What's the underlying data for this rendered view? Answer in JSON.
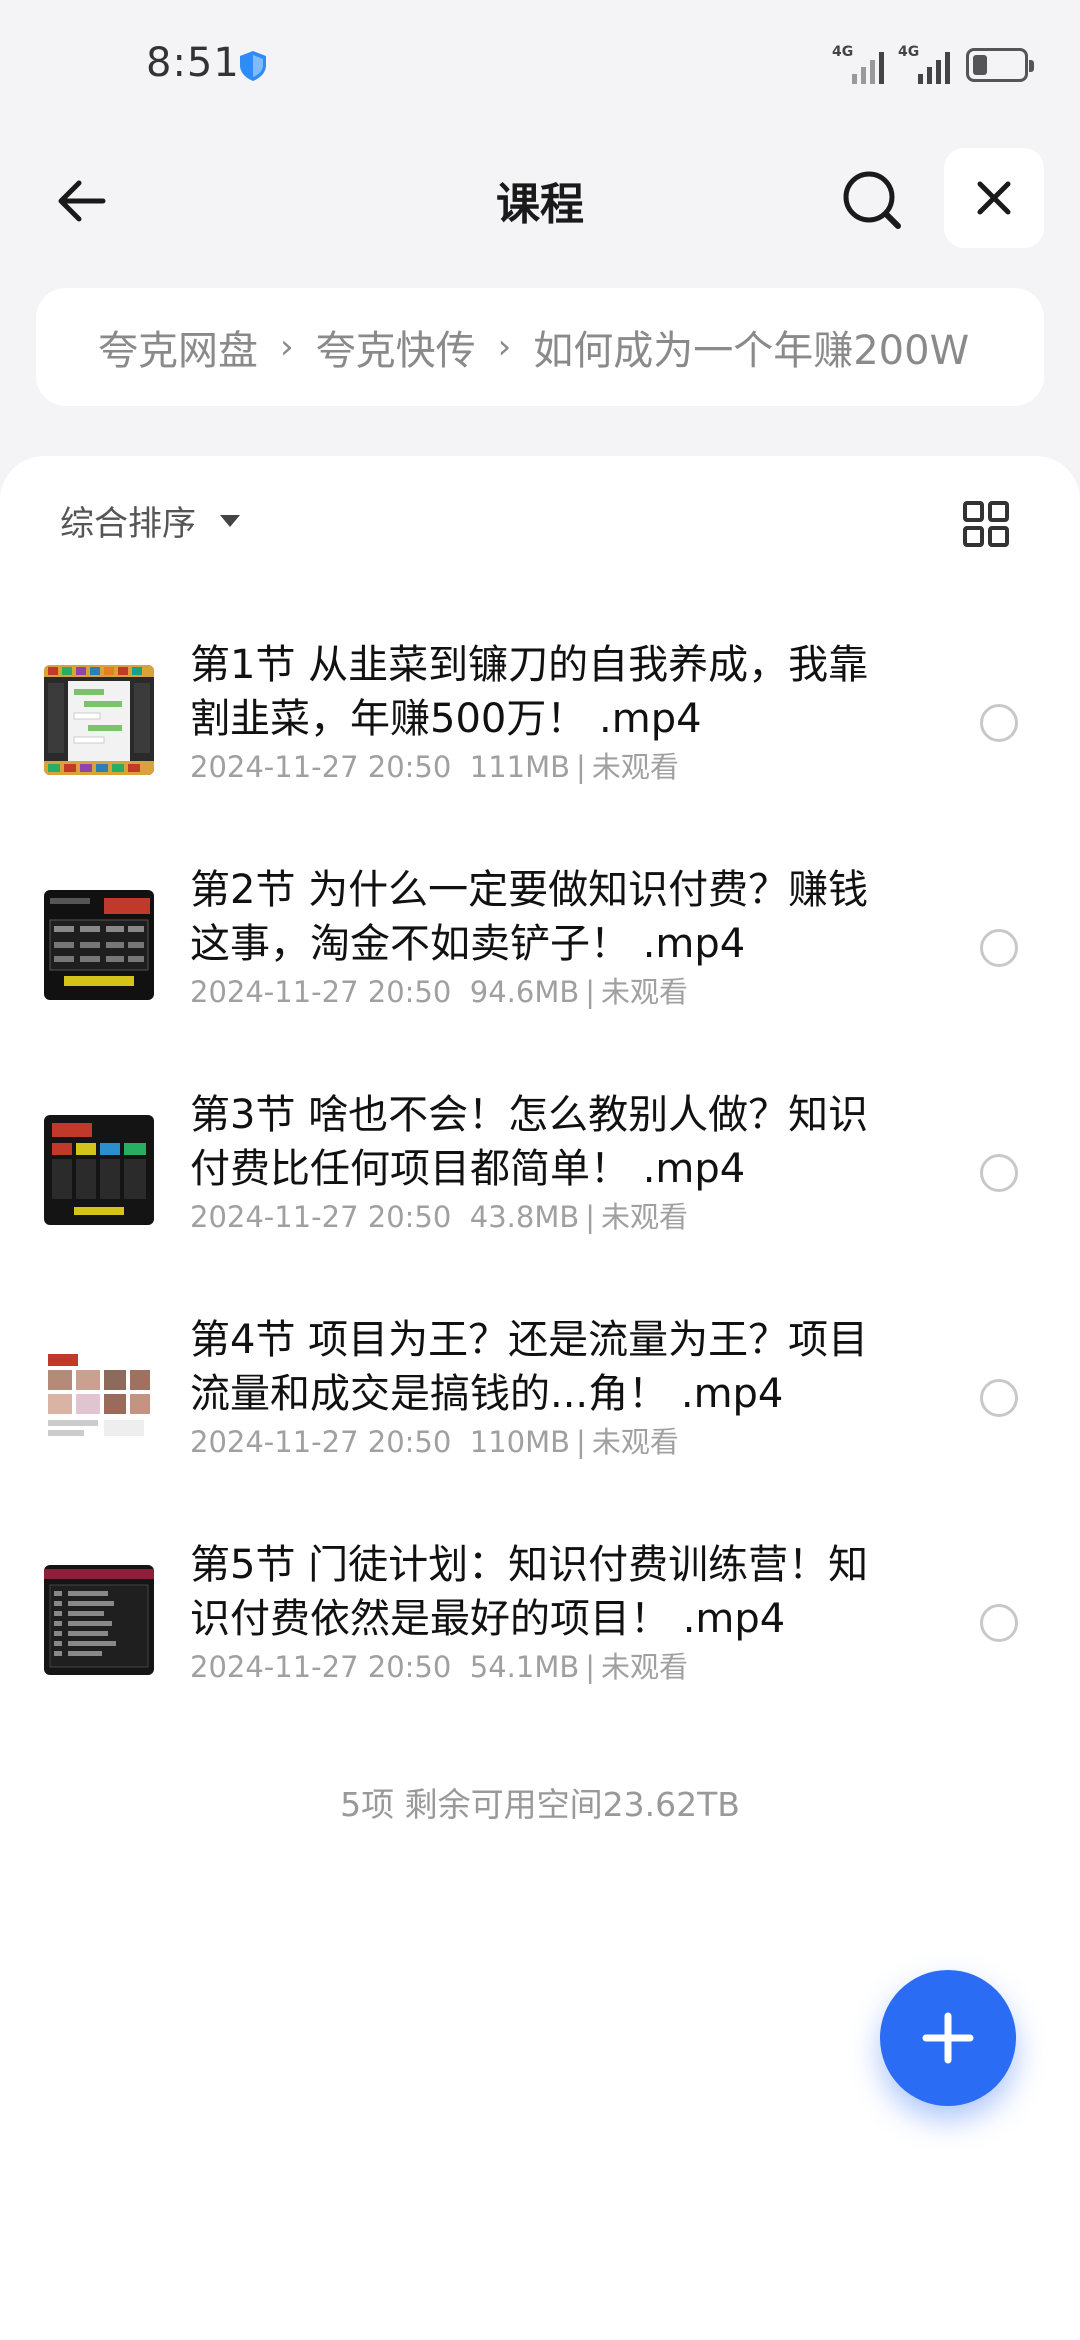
{
  "status_bar": {
    "time": "8:51",
    "network_1": "4G",
    "network_2": "4G",
    "battery_icon": "battery-low-icon"
  },
  "header": {
    "title": "课程",
    "back_icon": "arrow-left-icon",
    "search_icon": "search-icon",
    "close_icon": "close-icon"
  },
  "breadcrumb": {
    "items": [
      "夸克网盘",
      "夸克快传",
      "如何成为一个年赚200W"
    ],
    "separator": "›"
  },
  "toolbar": {
    "sort_label": "综合排序",
    "view_icon": "grid-view-icon"
  },
  "files": [
    {
      "name": "第1节 从韭菜到镰刀的自我养成，我靠割韭菜，年赚500万！  .mp4",
      "date": "2024-11-27 20:50",
      "size": "111MB",
      "status": "未观看"
    },
    {
      "name": "第2节 为什么一定要做知识付费？赚钱这事，淘金不如卖铲子！  .mp4",
      "date": "2024-11-27 20:50",
      "size": "94.6MB",
      "status": "未观看"
    },
    {
      "name": "第3节 啥也不会！怎么教别人做？知识付费比任何项目都简单！  .mp4",
      "date": "2024-11-27 20:50",
      "size": "43.8MB",
      "status": "未观看"
    },
    {
      "name": "第4节 项目为王？还是流量为王？项目流量和成交是搞钱的...角！  .mp4",
      "date": "2024-11-27 20:50",
      "size": "110MB",
      "status": "未观看"
    },
    {
      "name": "第5节 门徒计划：知识付费训练营！知识付费依然是最好的项目！  .mp4",
      "date": "2024-11-27 20:50",
      "size": "54.1MB",
      "status": "未观看"
    }
  ],
  "footer": {
    "summary": "5项 剩余可用空间23.62TB"
  },
  "fab": {
    "icon": "plus-icon"
  },
  "colors": {
    "accent": "#2a6cf3",
    "background": "#f4f4f6",
    "meta_text": "#a0a0a0"
  }
}
